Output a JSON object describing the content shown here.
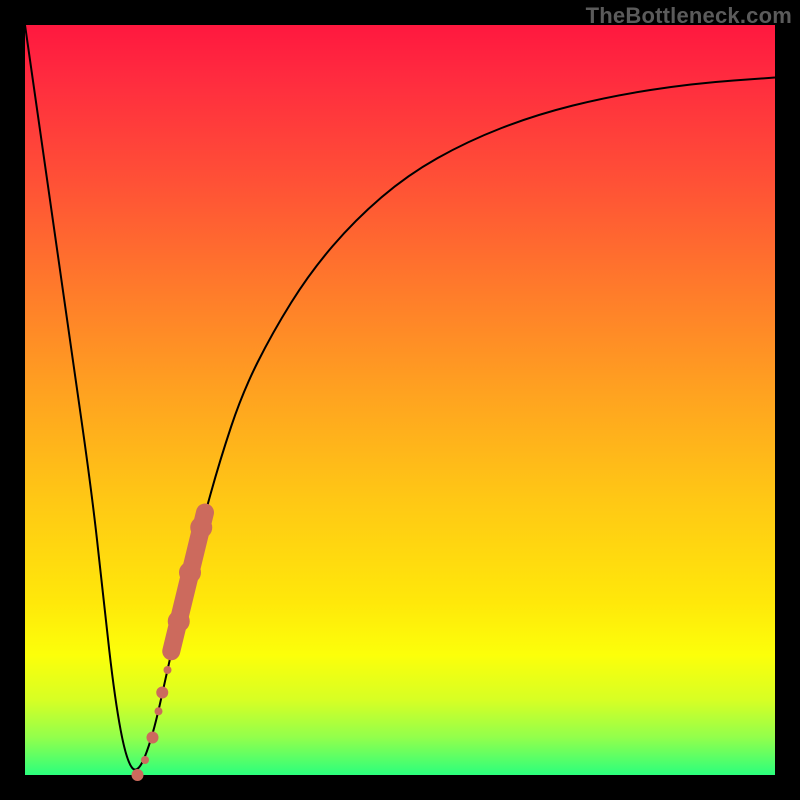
{
  "watermark": "TheBottleneck.com",
  "colors": {
    "curve": "#000000",
    "marker_fill": "#cc6a5d",
    "marker_stroke": "#b85a4f"
  },
  "chart_data": {
    "type": "line",
    "title": "",
    "xlabel": "",
    "ylabel": "",
    "xlim": [
      0,
      100
    ],
    "ylim": [
      0,
      100
    ],
    "curve": {
      "x": [
        0,
        3,
        6,
        9,
        10.5,
        12,
        13.5,
        15,
        17,
        19,
        21,
        23.5,
        26,
        29,
        33,
        38,
        44,
        51,
        59,
        68,
        78,
        89,
        100
      ],
      "y": [
        100,
        79,
        58,
        37,
        23,
        10,
        2,
        0,
        5,
        14,
        23,
        33,
        42,
        51,
        59,
        67,
        74,
        80,
        84.5,
        88,
        90.5,
        92.2,
        93
      ]
    },
    "markers": {
      "comment": "Salmon dashed-looking overlay segment & dots near trough",
      "points": [
        {
          "x": 15.0,
          "y": 0.0,
          "r": 6
        },
        {
          "x": 16.0,
          "y": 2.0,
          "r": 4
        },
        {
          "x": 17.0,
          "y": 5.0,
          "r": 6
        },
        {
          "x": 17.8,
          "y": 8.5,
          "r": 4
        },
        {
          "x": 18.3,
          "y": 11.0,
          "r": 6
        },
        {
          "x": 19.0,
          "y": 14.0,
          "r": 4
        },
        {
          "x": 20.5,
          "y": 20.5,
          "r": 11
        },
        {
          "x": 22.0,
          "y": 27.0,
          "r": 11
        },
        {
          "x": 23.5,
          "y": 33.0,
          "r": 11
        }
      ],
      "thick_segment": {
        "x0": 19.5,
        "y0": 16.5,
        "x1": 24.0,
        "y1": 35.0,
        "w": 18
      }
    }
  }
}
